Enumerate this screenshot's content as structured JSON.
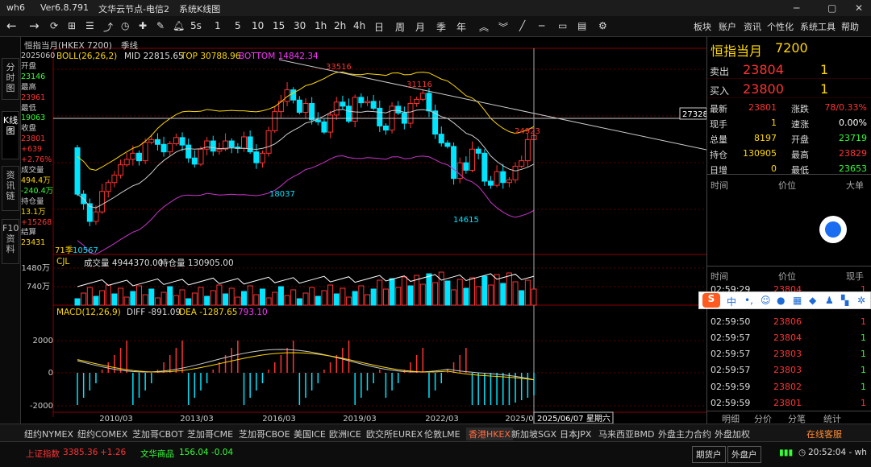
{
  "titlebar": {
    "app": "wh6",
    "version": "Ver6.8.791",
    "node": "文华云节点-电信2",
    "mode": "系统K线图"
  },
  "toolbar": {
    "periods": [
      "1",
      "5",
      "10",
      "15",
      "30",
      "1h",
      "2h",
      "4h",
      "日",
      "周",
      "月",
      "季",
      "年"
    ],
    "period_5s": "5s",
    "right": [
      "板块",
      "账户",
      "资讯",
      "个性化",
      "系统工具",
      "帮助"
    ]
  },
  "lefttabs": [
    "分时图",
    "K线图",
    "资讯链",
    "F10资料"
  ],
  "chart": {
    "instrument": "恒指当月(HKEX 7200)",
    "period": "季线",
    "boll": {
      "label": "BOLL(26,26,2)",
      "mid": "MID 22815.65",
      "top": "TOP 30788.96",
      "bottom": "BOTTOM 14842.34"
    },
    "info": [
      [
        "20250607",
        "#ccc"
      ],
      [
        "开盘",
        "#ccc"
      ],
      [
        "23146",
        "#33ff33"
      ],
      [
        "最高",
        "#ccc"
      ],
      [
        "23961",
        "#ff3333"
      ],
      [
        "最低",
        "#ccc"
      ],
      [
        "19063",
        "#33ff33"
      ],
      [
        "收盘",
        "#ccc"
      ],
      [
        "23801",
        "#ff3333"
      ],
      [
        "+639",
        "#ff3333"
      ],
      [
        "+2.76%",
        "#ff3333"
      ],
      [
        "成交量",
        "#ccc"
      ],
      [
        "494.4万",
        "#ffd700"
      ],
      [
        "-240.4万",
        "#33ff33"
      ],
      [
        "持仓量",
        "#ccc"
      ],
      [
        "13.1万",
        "#ffd700"
      ],
      [
        "+15268",
        "#ff3333"
      ],
      [
        "结算",
        "#ccc"
      ],
      [
        "23431",
        "#ffd700"
      ]
    ],
    "price_labels": {
      "p33516": "33516",
      "p31116": "31116",
      "p24923": "24923",
      "p18037": "18037",
      "p14615": "14615",
      "p10567": "10567",
      "h27328": "27328",
      "q71": "71季"
    },
    "cjl": {
      "label": "CJL",
      "vol": "成交量 4944370.00",
      "oi": "持仓量 130905.00",
      "ticks": [
        "1480万",
        "740万"
      ]
    },
    "macd": {
      "label": "MACD(12,26,9)",
      "diff": "DIFF -891.09",
      "dea": "DEA -1287.65",
      "macd": "793.10",
      "ticks": [
        "2000",
        "0",
        "-2000"
      ]
    },
    "xaxis": [
      "2010/03",
      "2013/03",
      "2016/03",
      "2019/03",
      "2022/03",
      "2025/0"
    ],
    "cursor_date": "2025/06/07 星期六"
  },
  "quote": {
    "name": "恒指当月",
    "code": "7200",
    "sell": {
      "label": "卖出",
      "price": "23804",
      "qty": "1"
    },
    "buy": {
      "label": "买入",
      "price": "23800",
      "qty": "1"
    },
    "stats": [
      {
        "l1": "最新",
        "v1": "23801",
        "c1": "#ff3333",
        "l2": "涨跌",
        "v2": "78/0.33%",
        "c2": "#ff3333"
      },
      {
        "l1": "现手",
        "v1": "1",
        "c1": "#ffd700",
        "l2": "速涨",
        "v2": "0.00%",
        "c2": "#ffffff"
      },
      {
        "l1": "总量",
        "v1": "8197",
        "c1": "#ffd700",
        "l2": "开盘",
        "v2": "23719",
        "c2": "#33ff33"
      },
      {
        "l1": "持仓",
        "v1": "130905",
        "c1": "#ffd700",
        "l2": "最高",
        "v2": "23829",
        "c2": "#ff3333"
      },
      {
        "l1": "日增",
        "v1": "0",
        "c1": "#ffd700",
        "l2": "最低",
        "v2": "23653",
        "c2": "#33ff33"
      }
    ],
    "hdr1": [
      "时间",
      "价位",
      "大单"
    ],
    "hdr2": [
      "时间",
      "价位",
      "现手"
    ],
    "ticks": [
      {
        "t": "02:59:29",
        "p": "23804",
        "n": "1",
        "c": "#ff3333",
        "nc": "#ff3333"
      },
      {
        "t": "02:59:50",
        "p": "23806",
        "n": "1",
        "c": "#ff3333",
        "nc": "#ff3333"
      },
      {
        "t": "02:59:57",
        "p": "23804",
        "n": "1",
        "c": "#ff3333",
        "nc": "#33ff33"
      },
      {
        "t": "02:59:57",
        "p": "23803",
        "n": "1",
        "c": "#ff3333",
        "nc": "#33ff33"
      },
      {
        "t": "02:59:57",
        "p": "23803",
        "n": "1",
        "c": "#ff3333",
        "nc": "#33ff33"
      },
      {
        "t": "02:59:59",
        "p": "23802",
        "n": "1",
        "c": "#ff3333",
        "nc": "#33ff33"
      },
      {
        "t": "02:59:59",
        "p": "23801",
        "n": "1",
        "c": "#ff3333",
        "nc": "#ff3333"
      }
    ],
    "subtabs": [
      "明细",
      "分价",
      "分笔",
      "统计"
    ]
  },
  "bottomtabs": [
    "纽约NYMEX",
    "纽约COMEX",
    "芝加哥CBOT",
    "芝加哥CME",
    "芝加哥CBOE",
    "美国ICE",
    "欧洲ICE",
    "欧交所EUREX",
    "伦敦LME",
    "香港HKEX",
    "新加坡SGX",
    "日本JPX",
    "马来西亚BMD",
    "外盘主力合约",
    "外盘加权"
  ],
  "bottom_right": "在线客服",
  "status": {
    "sh_label": "上证指数",
    "sh_val": "3385.36",
    "sh_chg": "+1.26",
    "wh_label": "文华商品",
    "wh_val": "156.04",
    "wh_chg": "-0.04",
    "btn1": "期货户",
    "btn2": "外盘户",
    "time": "20:52:04 - wh"
  },
  "ime": {
    "logo": "S",
    "lang": "中"
  }
}
